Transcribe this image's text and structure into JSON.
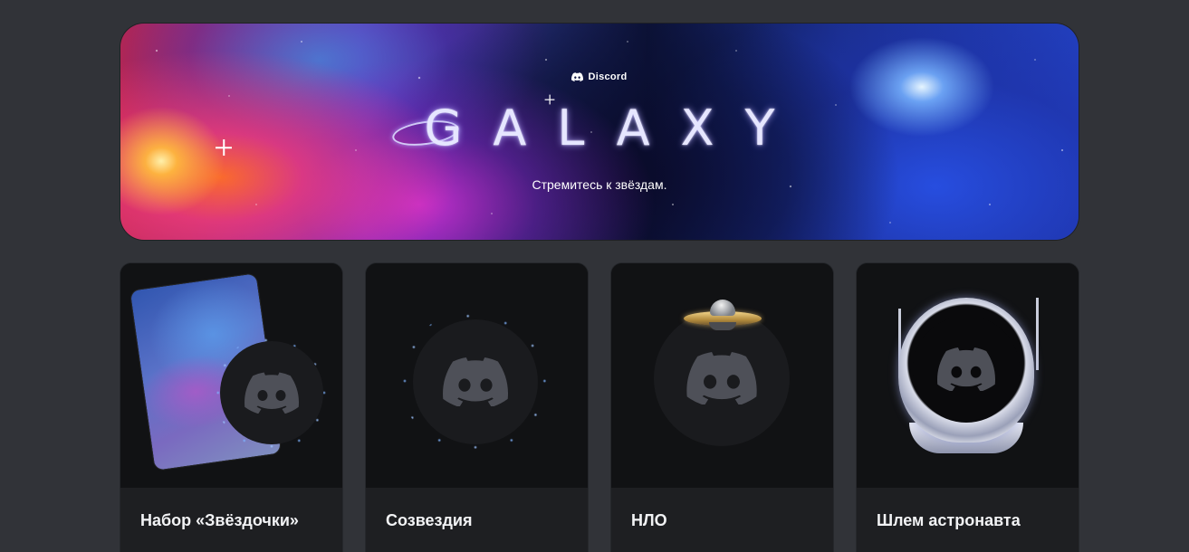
{
  "banner": {
    "brand_name": "Discord",
    "title": "GALAXY",
    "tagline": "Стремитесь к звёздам.",
    "colors": {
      "left_nebula": "#b8244f",
      "center_space": "#0c1236",
      "right_galaxy": "#2240c0"
    }
  },
  "cards": [
    {
      "title": "Набор «Звёздочки»",
      "art": "nebula-card-with-sparkle-avatar-decoration"
    },
    {
      "title": "Созвездия",
      "art": "constellation-ring-avatar-decoration"
    },
    {
      "title": "НЛО",
      "art": "ufo-avatar-decoration"
    },
    {
      "title": "Шлем астронавта",
      "art": "astronaut-helmet-avatar-decoration"
    }
  ],
  "icons": {
    "brand": "discord-logo-icon",
    "avatar": "discord-logo-icon"
  },
  "colors": {
    "page_background": "#313338",
    "card_background": "#111214",
    "card_footer": "#1e1f22",
    "avatar_glyph": "#4e5058",
    "sparkle": "#7fb3ff"
  }
}
